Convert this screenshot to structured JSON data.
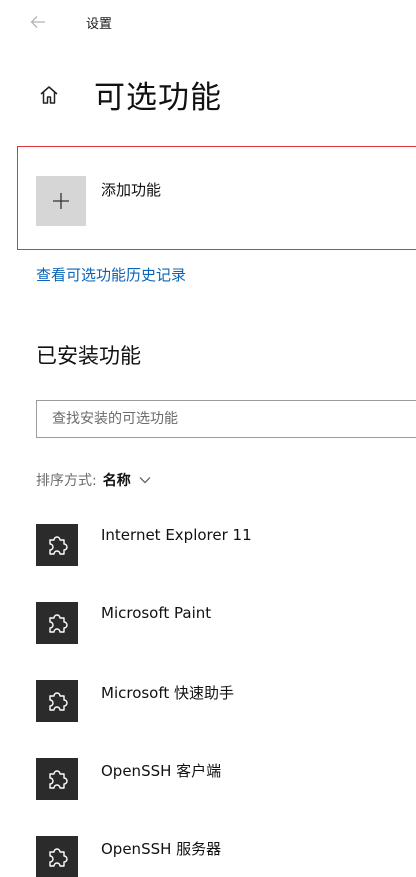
{
  "app": {
    "title": "设置"
  },
  "page": {
    "title": "可选功能"
  },
  "add_feature": {
    "label": "添加功能"
  },
  "history_link": "查看可选功能历史记录",
  "installed": {
    "title": "已安装功能",
    "search_placeholder": "查找安装的可选功能",
    "sort_label": "排序方式:",
    "sort_value": "名称",
    "items": [
      {
        "name": "Internet Explorer 11"
      },
      {
        "name": "Microsoft Paint"
      },
      {
        "name": "Microsoft 快速助手"
      },
      {
        "name": "OpenSSH 客户端"
      },
      {
        "name": "OpenSSH 服务器"
      }
    ]
  },
  "icons": {
    "back": "back-arrow-icon",
    "home": "home-icon",
    "add": "plus-icon",
    "sort": "chevron-down-icon",
    "feature": "puzzle-piece-icon"
  },
  "colors": {
    "highlight_border": "#e2363f",
    "link": "#0a64b8",
    "feature_tile": "#2b2b2b",
    "add_tile": "#d6d6d6"
  }
}
